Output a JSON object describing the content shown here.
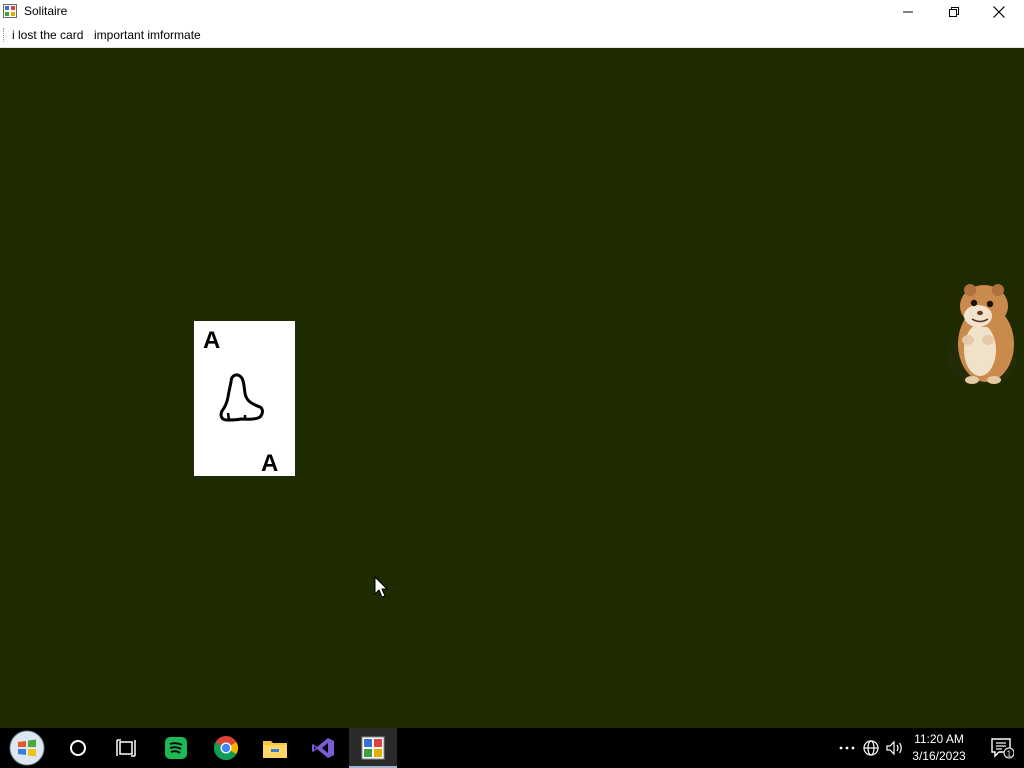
{
  "window": {
    "title": "Solitaire",
    "app_icon": "solitaire-app-icon",
    "controls": [
      "minimize-icon",
      "maximize-icon",
      "close-icon"
    ]
  },
  "menu": {
    "items": [
      {
        "label": "i lost the card"
      },
      {
        "label": "important imformate"
      }
    ]
  },
  "game": {
    "background": "#1e2b00",
    "card": {
      "rank_top": "A",
      "rank_bottom": "A",
      "suit_icon": "hand-drawn-suit-icon",
      "background": "#ffffff"
    },
    "character_icon": "hamster-icon"
  },
  "taskbar": {
    "buttons": [
      {
        "icon": "start-icon"
      },
      {
        "icon": "cortana-icon"
      },
      {
        "icon": "task-view-icon"
      },
      {
        "icon": "spotify-icon",
        "color": "#1db954"
      },
      {
        "icon": "chrome-icon"
      },
      {
        "icon": "file-explorer-icon",
        "color": "#f6c342"
      },
      {
        "icon": "visual-studio-icon",
        "color": "#7b5cd6"
      },
      {
        "icon": "solitaire-taskbar-icon",
        "active": true
      }
    ],
    "tray": [
      "overflow-icon",
      "network-icon",
      "volume-icon"
    ],
    "clock": {
      "time": "11:20 AM",
      "date": "3/16/2023"
    },
    "notifications": {
      "icon": "notification-icon",
      "count": "1"
    }
  }
}
